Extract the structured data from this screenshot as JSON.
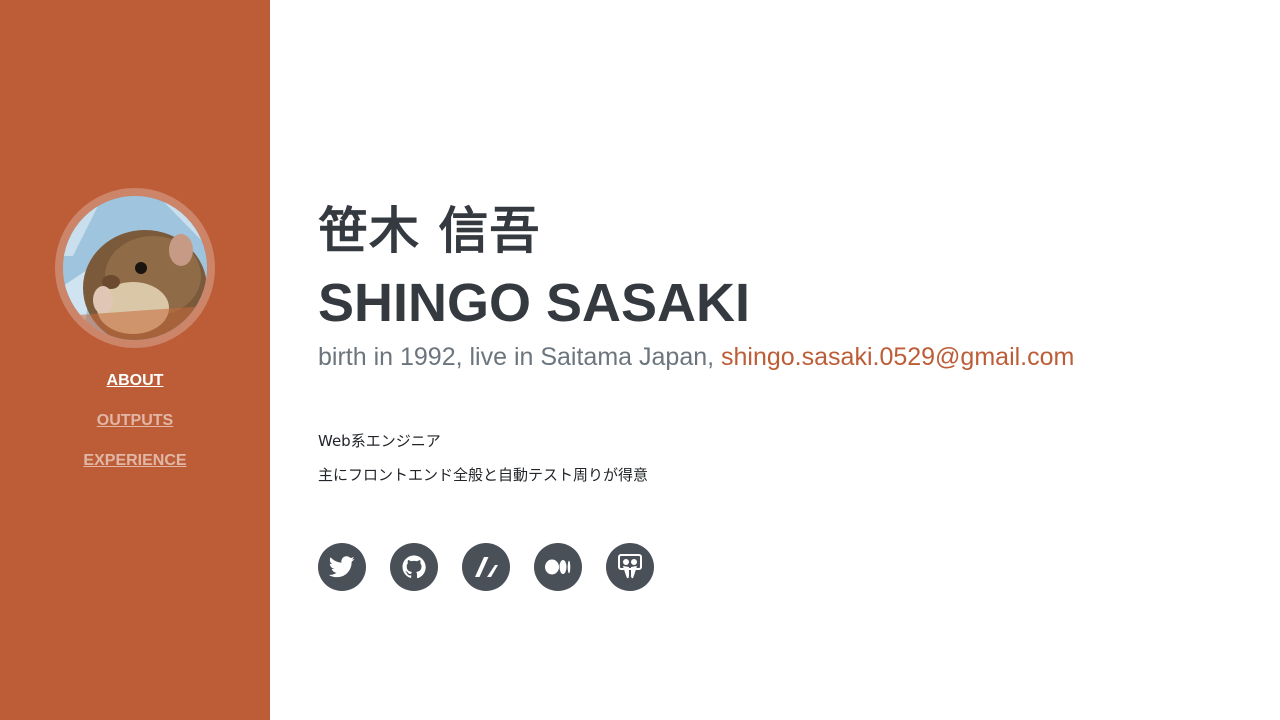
{
  "sidebar": {
    "background": "#bd5d38",
    "nav": [
      {
        "label": "ABOUT",
        "active": true
      },
      {
        "label": "OUTPUTS",
        "active": false
      },
      {
        "label": "EXPERIENCE",
        "active": false
      }
    ]
  },
  "profile": {
    "name_jp": "笹木 信吾",
    "name_en": "SHINGO SASAKI",
    "subheading_prefix": "birth in 1992, live in Saitama Japan, ",
    "email": "shingo.sasaki.0529@gmail.com",
    "description": [
      "Web系エンジニア",
      "主にフロントエンド全般と自動テスト周りが得意"
    ]
  },
  "socials": [
    {
      "icon": "twitter-icon"
    },
    {
      "icon": "github-icon"
    },
    {
      "icon": "zenn-icon"
    },
    {
      "icon": "medium-icon"
    },
    {
      "icon": "slideshare-icon"
    }
  ],
  "colors": {
    "accent": "#bd5d38",
    "heading": "#343a40",
    "muted": "#6c757d",
    "social_bg": "#495057"
  }
}
